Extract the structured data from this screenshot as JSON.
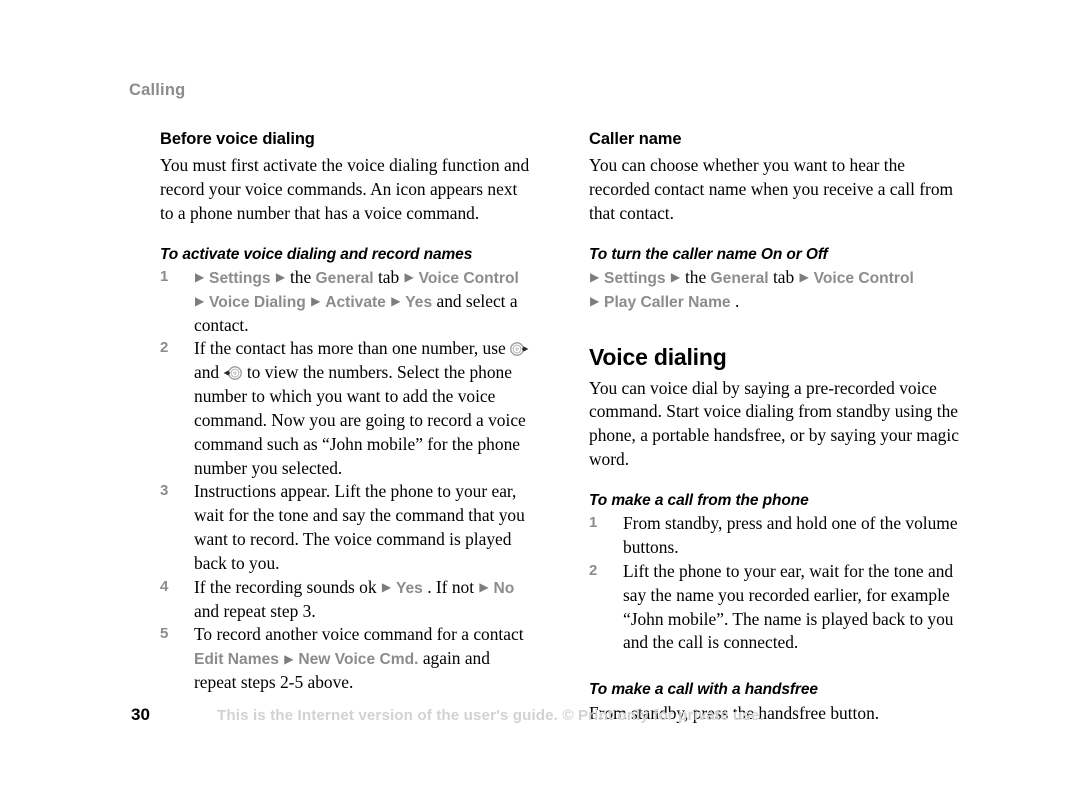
{
  "page": {
    "running_head": "Calling",
    "page_number": "30",
    "footer_notice": "This is the Internet version of the user's guide. © Print only for private use.",
    "menu_marker": "▶"
  },
  "left_column": {
    "heading": "Before voice dialing",
    "intro": "You must first activate the voice dialing function and record your voice commands. An icon appears next to a phone number that has a voice command.",
    "procedure_heading": "To activate voice dialing and record names",
    "steps": [
      {
        "number": "1",
        "parts": [
          {
            "type": "marker"
          },
          {
            "type": "menu",
            "text": "Settings"
          },
          {
            "type": "marker"
          },
          {
            "type": "plain",
            "text": "the "
          },
          {
            "type": "menu",
            "text": "General"
          },
          {
            "type": "plain",
            "text": " tab "
          },
          {
            "type": "marker"
          },
          {
            "type": "menu",
            "text": "Voice Control"
          },
          {
            "type": "marker"
          },
          {
            "type": "menu",
            "text": "Voice Dialing"
          },
          {
            "type": "marker"
          },
          {
            "type": "menu",
            "text": "Activate"
          },
          {
            "type": "marker"
          },
          {
            "type": "menu",
            "text": "Yes"
          },
          {
            "type": "plain",
            "text": " and select a contact."
          }
        ]
      },
      {
        "number": "2",
        "parts": [
          {
            "type": "plain",
            "text": "If the contact has more than one number, use "
          },
          {
            "type": "icon",
            "icon": "nav-key-right"
          },
          {
            "type": "plain",
            "text": " and "
          },
          {
            "type": "icon",
            "icon": "nav-key-left"
          },
          {
            "type": "plain",
            "text": " to view the numbers. Select the phone number to which you want to add the voice command. Now you are going to record a voice command such as “John mobile” for the phone number you selected."
          }
        ]
      },
      {
        "number": "3",
        "parts": [
          {
            "type": "plain",
            "text": "Instructions appear. Lift the phone to your ear, wait for the tone and say the command that you want to record. The voice command is played back to you."
          }
        ]
      },
      {
        "number": "4",
        "parts": [
          {
            "type": "plain",
            "text": "If the recording sounds ok "
          },
          {
            "type": "marker"
          },
          {
            "type": "menu",
            "text": "Yes"
          },
          {
            "type": "plain",
            "text": ". If not "
          },
          {
            "type": "marker"
          },
          {
            "type": "menu",
            "text": "No"
          },
          {
            "type": "plain",
            "text": " and repeat step 3."
          }
        ]
      },
      {
        "number": "5",
        "parts": [
          {
            "type": "plain",
            "text": "To record another voice command for a contact "
          },
          {
            "type": "menu",
            "text": "Edit Names"
          },
          {
            "type": "marker"
          },
          {
            "type": "menu",
            "text": "New Voice Cmd."
          },
          {
            "type": "plain",
            "text": " again and repeat steps 2-5 above."
          }
        ]
      }
    ]
  },
  "right_column": {
    "caller_name": {
      "heading": "Caller name",
      "intro": "You can choose whether you want to hear the recorded contact name when you receive a call from that contact.",
      "procedure_heading": "To turn the caller name On or Off",
      "path_parts": [
        {
          "type": "marker"
        },
        {
          "type": "menu",
          "text": "Settings"
        },
        {
          "type": "marker"
        },
        {
          "type": "plain",
          "text": "the "
        },
        {
          "type": "menu",
          "text": "General"
        },
        {
          "type": "plain",
          "text": " tab "
        },
        {
          "type": "marker"
        },
        {
          "type": "menu",
          "text": "Voice Control"
        },
        {
          "type": "break"
        },
        {
          "type": "marker"
        },
        {
          "type": "menu",
          "text": "Play Caller Name"
        },
        {
          "type": "plain",
          "text": "."
        }
      ]
    },
    "voice_dialing": {
      "heading": "Voice dialing",
      "intro": "You can voice dial by saying a pre-recorded voice command. Start voice dialing from standby using the phone, a portable handsfree, or by saying your magic word.",
      "procedure_heading": "To make a call from the phone",
      "steps": [
        {
          "number": "1",
          "parts": [
            {
              "type": "plain",
              "text": "From standby, press and hold one of the volume buttons."
            }
          ]
        },
        {
          "number": "2",
          "parts": [
            {
              "type": "plain",
              "text": "Lift the phone to your ear, wait for the tone and say the name you recorded earlier, for example “John mobile”. The name is played back to you and the call is connected."
            }
          ]
        }
      ]
    },
    "handsfree": {
      "procedure_heading": "To make a call with a handsfree",
      "body": "From standby, press the handsfree button."
    }
  }
}
